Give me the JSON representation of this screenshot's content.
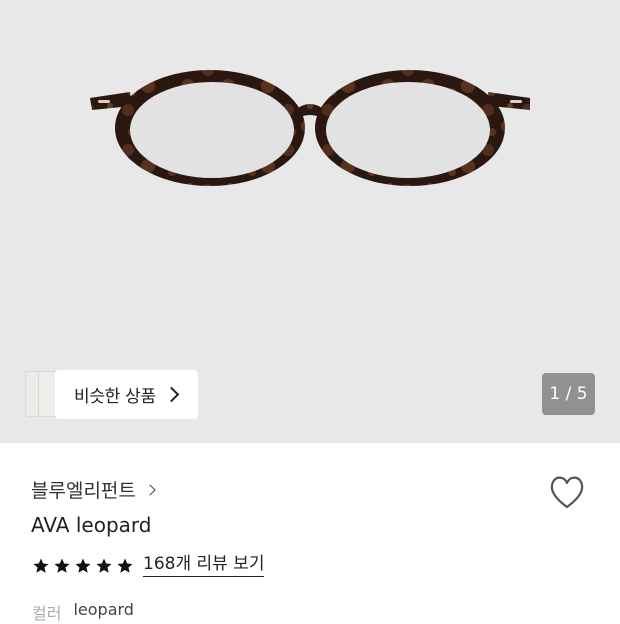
{
  "hero": {
    "image_alt": "tortoiseshell oval glasses"
  },
  "similar": {
    "label": "비슷한 상품"
  },
  "counter": {
    "text": "1 / 5"
  },
  "product": {
    "brand": "블루엘리펀트",
    "name": "AVA leopard",
    "rating_stars": 5,
    "review_link": "168개 리뷰 보기",
    "color_label": "컬러",
    "color_value": "leopard"
  },
  "icons": {
    "heart": "heart-outline-icon",
    "star": "star-filled-icon",
    "chevron": "chevron-right-icon"
  },
  "colors": {
    "hero_bg": "#e8e8e8",
    "frame": "#3a2418"
  }
}
